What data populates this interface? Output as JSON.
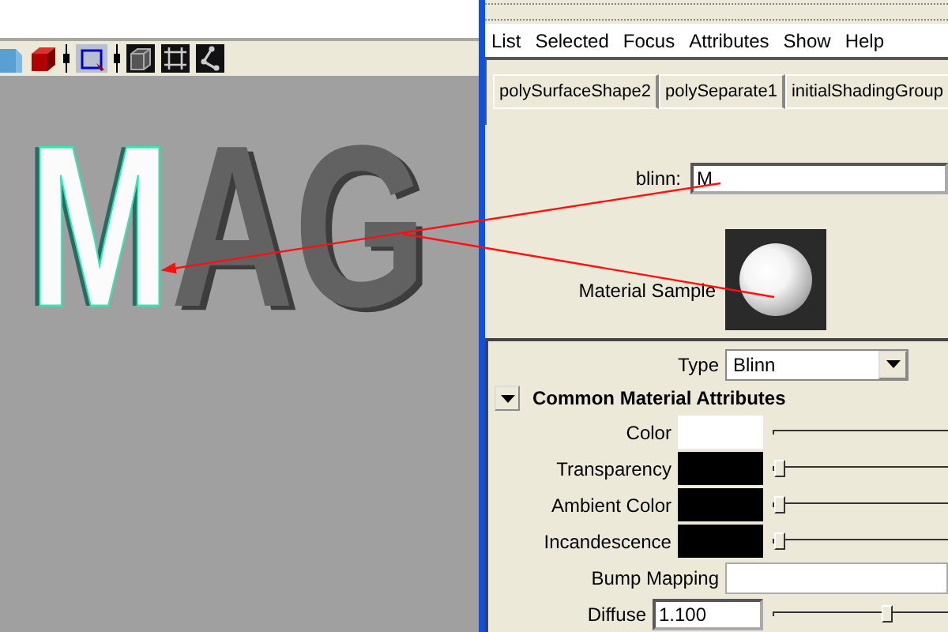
{
  "toolbar": [
    {
      "kind": "blue-cube",
      "selected": false
    },
    {
      "kind": "red-cube",
      "selected": false
    },
    {
      "kind": "separator"
    },
    {
      "kind": "select-box",
      "selected": true
    },
    {
      "kind": "separator"
    },
    {
      "kind": "wire-cube",
      "selected": false
    },
    {
      "kind": "frame",
      "selected": false
    },
    {
      "kind": "chain",
      "selected": false
    }
  ],
  "model_letters": [
    {
      "text": "M",
      "selected": true
    },
    {
      "text": "A",
      "selected": false
    },
    {
      "text": "G",
      "selected": false
    }
  ],
  "menu": [
    "List",
    "Selected",
    "Focus",
    "Attributes",
    "Show",
    "Help"
  ],
  "tabs": [
    {
      "label": "polySurfaceShape2"
    },
    {
      "label": "polySeparate1"
    },
    {
      "label": "initialShadingGroup"
    }
  ],
  "name_field": {
    "label": "blinn:",
    "value": "M"
  },
  "material_sample": {
    "label": "Material Sample"
  },
  "type_field": {
    "label": "Type",
    "value": "Blinn"
  },
  "section": {
    "title": "Common Material Attributes",
    "expanded": true
  },
  "attributes": [
    {
      "kind": "color",
      "label": "Color",
      "color": "#ffffff"
    },
    {
      "kind": "color",
      "label": "Transparency",
      "color": "#000000",
      "level": 0
    },
    {
      "kind": "color",
      "label": "Ambient Color",
      "color": "#000000",
      "level": 0
    },
    {
      "kind": "color",
      "label": "Incandescence",
      "color": "#000000",
      "level": 0
    },
    {
      "kind": "map",
      "label": "Bump Mapping"
    },
    {
      "kind": "number",
      "label": "Diffuse",
      "value": "1.100",
      "level": 0.62
    }
  ]
}
